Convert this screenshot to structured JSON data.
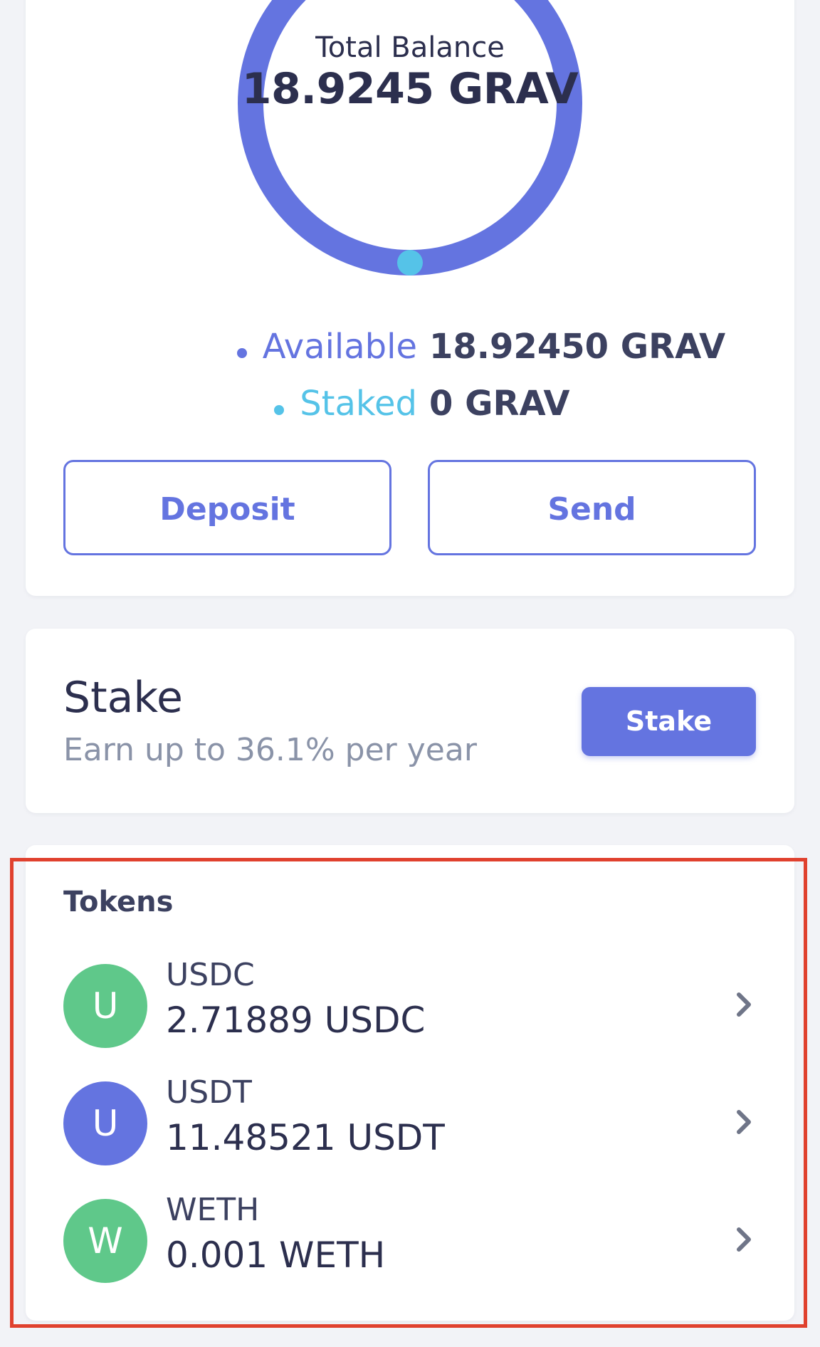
{
  "balance": {
    "label": "Total Balance",
    "value": "18.9245 GRAV",
    "legend": [
      {
        "name": "Available",
        "value": "18.92450 GRAV",
        "color": "#6474e0"
      },
      {
        "name": "Staked",
        "value": "0 GRAV",
        "color": "#55c3e8"
      }
    ],
    "staked_fraction": 0,
    "donut_colors": {
      "available": "#6474e0",
      "staked": "#55c3e8"
    }
  },
  "actions": {
    "deposit_label": "Deposit",
    "send_label": "Send"
  },
  "stake": {
    "title": "Stake",
    "subtitle": "Earn up to 36.1% per year",
    "button_label": "Stake"
  },
  "tokens": {
    "title": "Tokens",
    "items": [
      {
        "initial": "U",
        "symbol": "USDC",
        "amount": "2.71889 USDC",
        "color": "#5fc88a",
        "icon": "chevron-right-icon"
      },
      {
        "initial": "U",
        "symbol": "USDT",
        "amount": "11.48521 USDT",
        "color": "#6474e0",
        "icon": "chevron-right-icon"
      },
      {
        "initial": "W",
        "symbol": "WETH",
        "amount": "0.001 WETH",
        "color": "#5fc88a",
        "icon": "chevron-right-icon"
      }
    ]
  },
  "highlight_color": "#e0412e"
}
